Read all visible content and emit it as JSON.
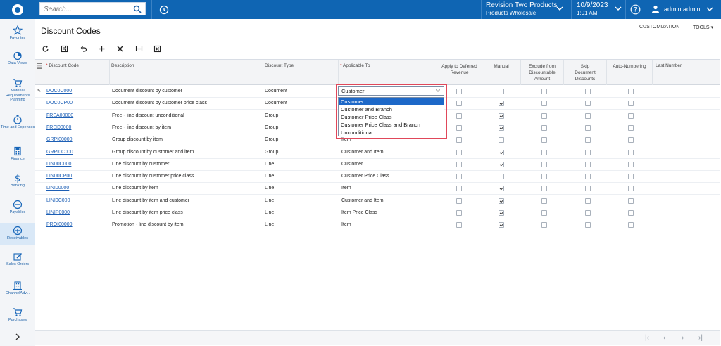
{
  "topbar": {
    "search_placeholder": "Search...",
    "company_name": "Revision Two Products",
    "company_branch": "Products Wholesale",
    "date": "10/9/2023",
    "time": "1:01 AM",
    "user": "admin admin"
  },
  "nav": [
    {
      "label": "Favorites",
      "icon": "star-icon"
    },
    {
      "label": "Data Views",
      "icon": "pie-chart-icon"
    },
    {
      "label": "Material Requirements Planning",
      "icon": "cart-icon"
    },
    {
      "label": "Time and Expenses",
      "icon": "stopwatch-icon"
    },
    {
      "label": "Finance",
      "icon": "calculator-icon"
    },
    {
      "label": "Banking",
      "icon": "dollar-icon"
    },
    {
      "label": "Payables",
      "icon": "minus-circle-icon"
    },
    {
      "label": "Receivables",
      "icon": "plus-circle-icon"
    },
    {
      "label": "Sales Orders",
      "icon": "pencil-icon"
    },
    {
      "label": "ChannelAdv...",
      "icon": "building-icon"
    },
    {
      "label": "Purchases",
      "icon": "cart-icon"
    }
  ],
  "page": {
    "title": "Discount Codes",
    "customization": "CUSTOMIZATION",
    "tools": "TOOLS"
  },
  "columns": {
    "code": "Discount Code",
    "description": "Description",
    "type": "Discount Type",
    "applicable": "Applicable To",
    "deferred": "Apply to Deferred Revenue",
    "manual": "Manual",
    "exclude": "Exclude from Discountable Amount",
    "skip": "Skip Document Discounts",
    "auto": "Auto-Numbering",
    "last": "Last Number"
  },
  "rows": [
    {
      "code": "DOC0C000",
      "description": "Document discount by customer",
      "type": "Document",
      "applicable": "Customer",
      "manual": false
    },
    {
      "code": "DOC0CP00",
      "description": "Document discount by customer price class",
      "type": "Document",
      "applicable": "",
      "manual": true
    },
    {
      "code": "FREA00000",
      "description": "Free - line discount unconditional",
      "type": "Group",
      "applicable": "",
      "manual": true
    },
    {
      "code": "FREI00000",
      "description": "Free - line discount by item",
      "type": "Group",
      "applicable": "",
      "manual": true
    },
    {
      "code": "GRPI00000",
      "description": "Group discount by item",
      "type": "Group",
      "applicable": "Item",
      "manual": false
    },
    {
      "code": "GRPI0C000",
      "description": "Group discount by customer and item",
      "type": "Group",
      "applicable": "Customer and Item",
      "manual": true
    },
    {
      "code": "LIN00C000",
      "description": "Line discount by customer",
      "type": "Line",
      "applicable": "Customer",
      "manual": true
    },
    {
      "code": "LIN00CP00",
      "description": "Line discount by customer price class",
      "type": "Line",
      "applicable": "Customer Price Class",
      "manual": false
    },
    {
      "code": "LINI00000",
      "description": "Line discount by item",
      "type": "Line",
      "applicable": "Item",
      "manual": true
    },
    {
      "code": "LINI0C000",
      "description": "Line discount by item and customer",
      "type": "Line",
      "applicable": "Customer and Item",
      "manual": true
    },
    {
      "code": "LINIP0000",
      "description": "Line discount by item price class",
      "type": "Line",
      "applicable": "Item Price Class",
      "manual": true
    },
    {
      "code": "PROI00000",
      "description": "Promotion - line discount by item",
      "type": "Line",
      "applicable": "Item",
      "manual": true
    }
  ],
  "dropdown": {
    "value": "Customer",
    "options": [
      "Customer",
      "Customer and Branch",
      "Customer Price Class",
      "Customer Price Class and Branch",
      "Unconditional"
    ],
    "selected_index": 0
  },
  "colors": {
    "brand": "#0f65b3",
    "highlight": "#e0485a",
    "selected_option": "#1d68c8",
    "link": "#1d5fb5"
  }
}
